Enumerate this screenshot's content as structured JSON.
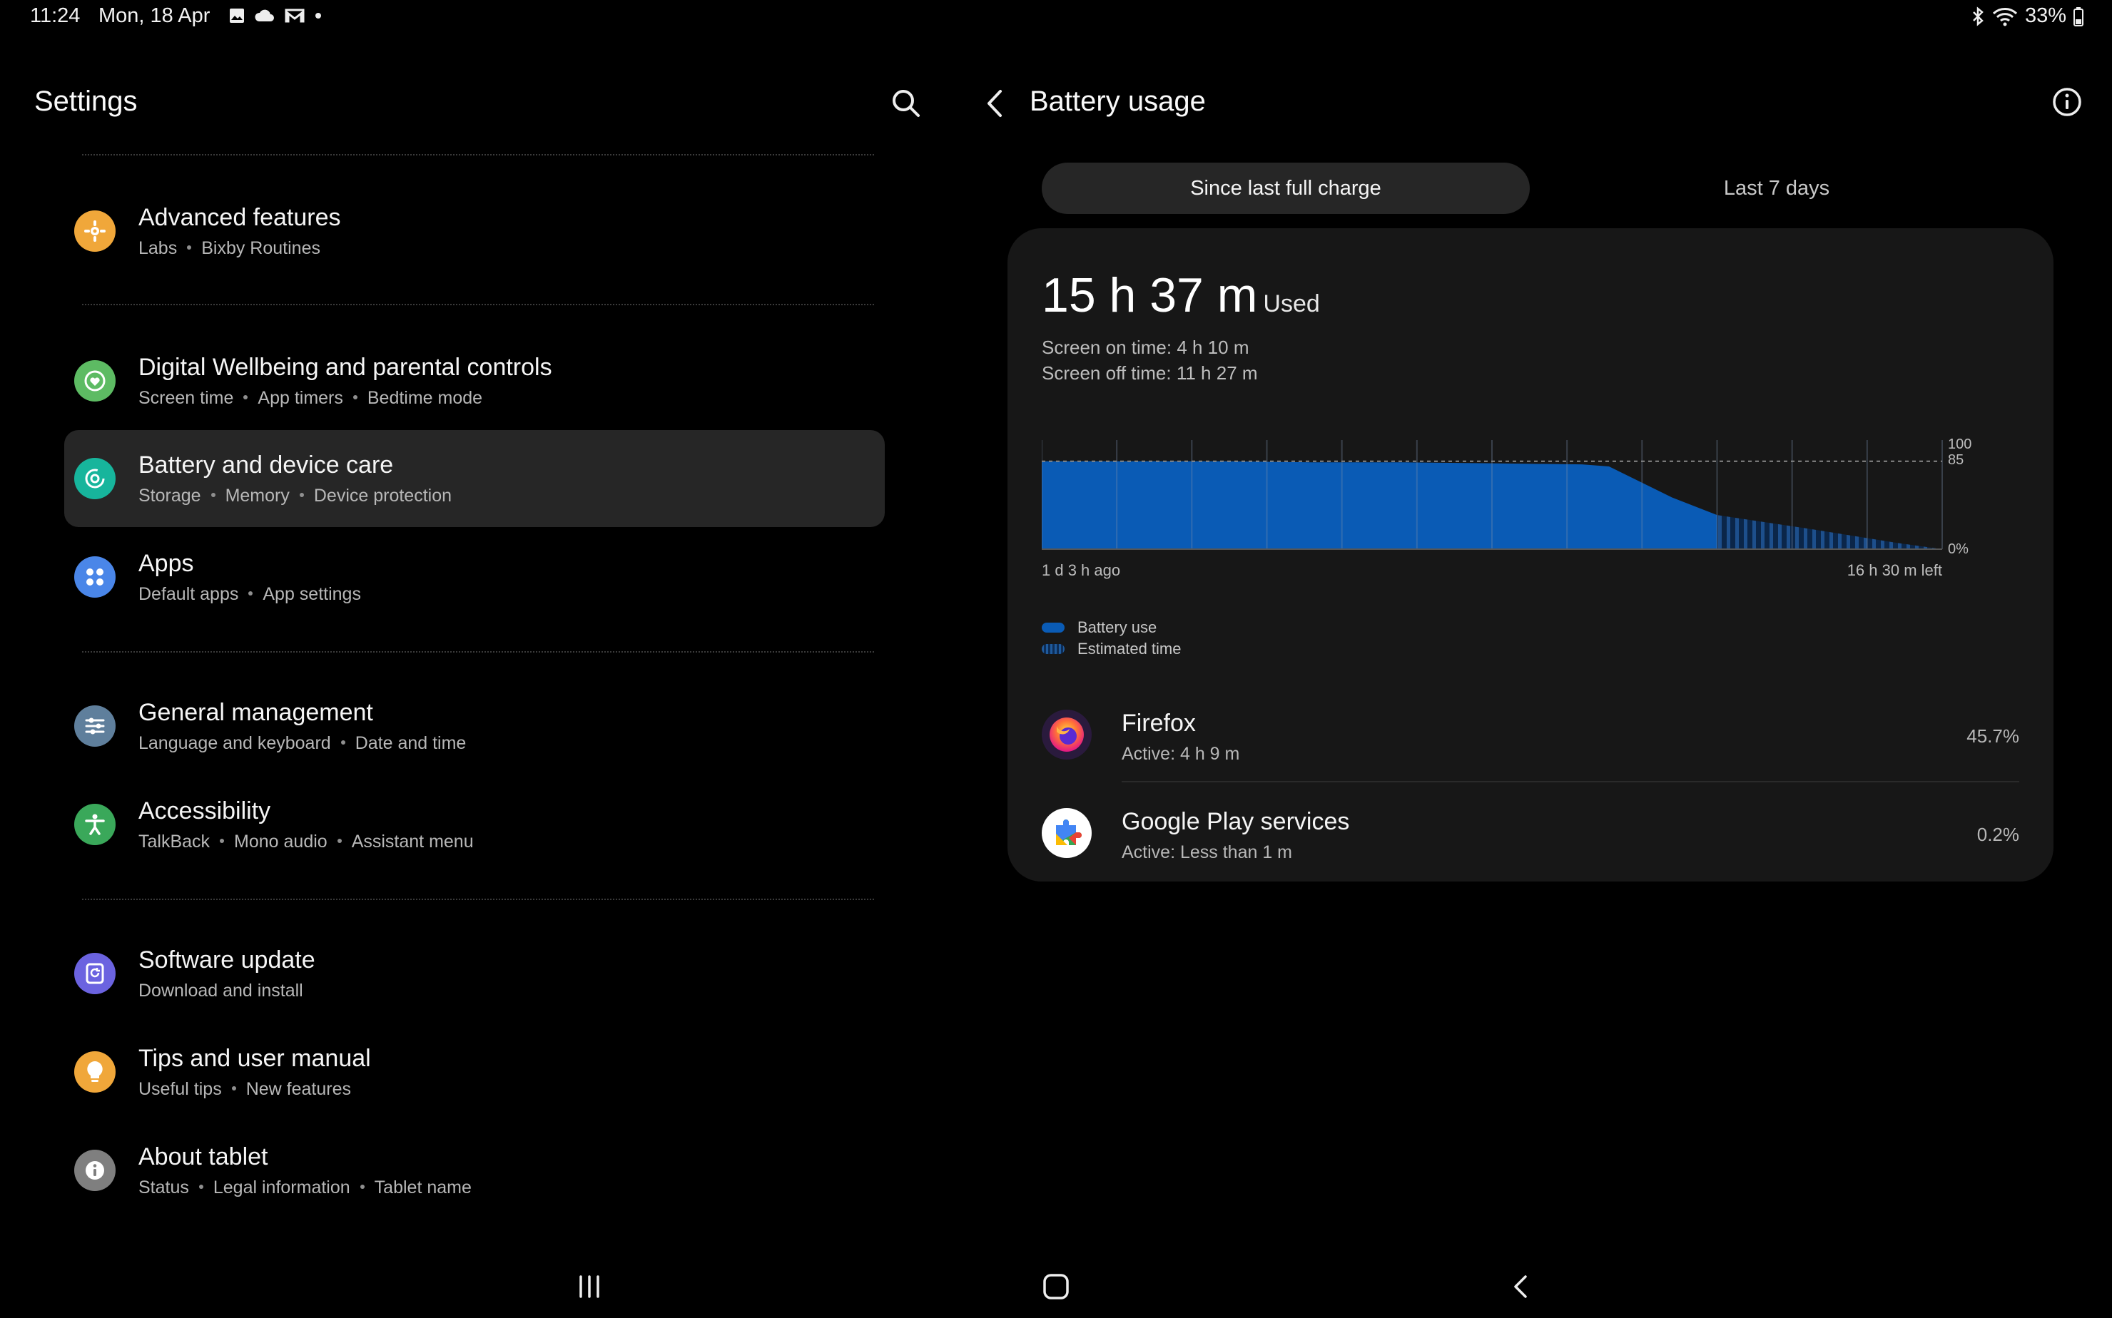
{
  "status": {
    "time": "11:24",
    "date": "Mon, 18 Apr",
    "battery": "33%",
    "icons": [
      "gallery-icon",
      "cloud-icon",
      "gmail-icon",
      "dot-icon",
      "bluetooth-icon",
      "wifi-icon",
      "battery-icon"
    ]
  },
  "left": {
    "title": "Settings",
    "items": [
      {
        "title": "Advanced features",
        "sub": [
          "Labs",
          "Bixby Routines"
        ],
        "color": "#f0a73a"
      },
      {
        "title": "Digital Wellbeing and parental controls",
        "sub": [
          "Screen time",
          "App timers",
          "Bedtime mode"
        ],
        "color": "#5dbb63"
      },
      {
        "title": "Battery and device care",
        "sub": [
          "Storage",
          "Memory",
          "Device protection"
        ],
        "color": "#17b59c"
      },
      {
        "title": "Apps",
        "sub": [
          "Default apps",
          "App settings"
        ],
        "color": "#4a86e8"
      },
      {
        "title": "General management",
        "sub": [
          "Language and keyboard",
          "Date and time"
        ],
        "color": "#5f7f9c"
      },
      {
        "title": "Accessibility",
        "sub": [
          "TalkBack",
          "Mono audio",
          "Assistant menu"
        ],
        "color": "#3aa85a"
      },
      {
        "title": "Software update",
        "sub": [
          "Download and install"
        ],
        "color": "#6b63e0"
      },
      {
        "title": "Tips and user manual",
        "sub": [
          "Useful tips",
          "New features"
        ],
        "color": "#f0a73a"
      },
      {
        "title": "About tablet",
        "sub": [
          "Status",
          "Legal information",
          "Tablet name"
        ],
        "color": "#7f7f7f"
      }
    ]
  },
  "right": {
    "title": "Battery usage",
    "tabs": {
      "active": "Since last full charge",
      "inactive": "Last 7 days"
    },
    "used_value": "15 h 37 m",
    "used_label": "Used",
    "screen_on": "Screen on time: 4 h 10 m",
    "screen_off": "Screen off time: 11 h 27 m",
    "legend": {
      "battery_use": "Battery use",
      "estimated": "Estimated time"
    },
    "apps": [
      {
        "name": "Firefox",
        "sub": "Active: 4 h 9 m",
        "pct": "45.7%"
      },
      {
        "name": "Google Play services",
        "sub": "Active: Less than 1 m",
        "pct": "0.2%"
      }
    ]
  },
  "chart_data": {
    "type": "area",
    "x_start_label": "1 d 3 h ago",
    "x_end_label": "16 h 30 m left",
    "y_tick_labels": [
      "100",
      "85",
      "0%"
    ],
    "ylim": [
      0,
      100
    ],
    "series": [
      {
        "name": "Battery use",
        "x": [
          0,
          0.1,
          0.2,
          0.3,
          0.4,
          0.5,
          0.6,
          0.63,
          0.7,
          0.75
        ],
        "y": [
          85,
          85,
          85,
          84,
          84,
          83,
          82,
          80,
          50,
          33
        ]
      },
      {
        "name": "Estimated time",
        "x": [
          0.75,
          0.85,
          0.95,
          1.0
        ],
        "y": [
          33,
          20,
          6,
          0
        ]
      }
    ],
    "colors": {
      "battery_use": "#0a5bb5",
      "estimated": "#0d3b73"
    }
  },
  "nav": {
    "icons": [
      "recents-icon",
      "home-icon",
      "back-icon"
    ]
  }
}
